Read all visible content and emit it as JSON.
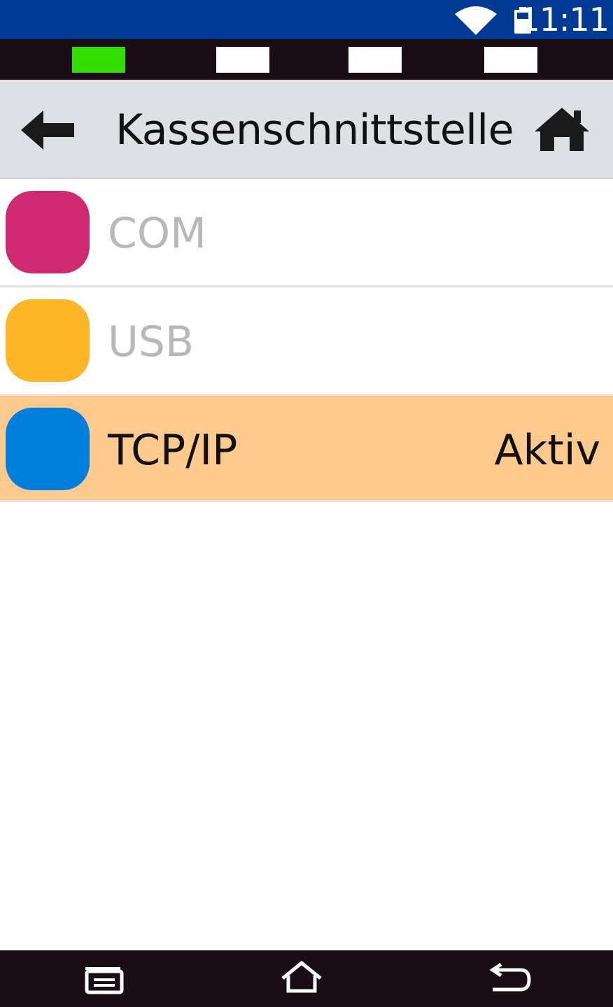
{
  "status_bar": {
    "time": "11:11",
    "icons": [
      "wifi-icon",
      "battery-icon"
    ],
    "background": "#003a94"
  },
  "indicators": [
    {
      "color": "#33dd00"
    },
    {
      "color": "#ffffff"
    },
    {
      "color": "#ffffff"
    },
    {
      "color": "#ffffff"
    }
  ],
  "header": {
    "title": "Kassenschnittstelle",
    "back_icon": "arrow-left-icon",
    "home_icon": "home-icon",
    "background": "#dde1e6"
  },
  "interfaces": [
    {
      "label": "COM",
      "color": "#cf2a72",
      "enabled": false,
      "status": ""
    },
    {
      "label": "USB",
      "color": "#feb627",
      "enabled": false,
      "status": ""
    },
    {
      "label": "TCP/IP",
      "color": "#0080dc",
      "enabled": true,
      "status": "Aktiv",
      "highlight": "#fec98c"
    }
  ],
  "nav_bar": {
    "icons": [
      "recent-apps-icon",
      "home-icon",
      "back-icon"
    ]
  }
}
